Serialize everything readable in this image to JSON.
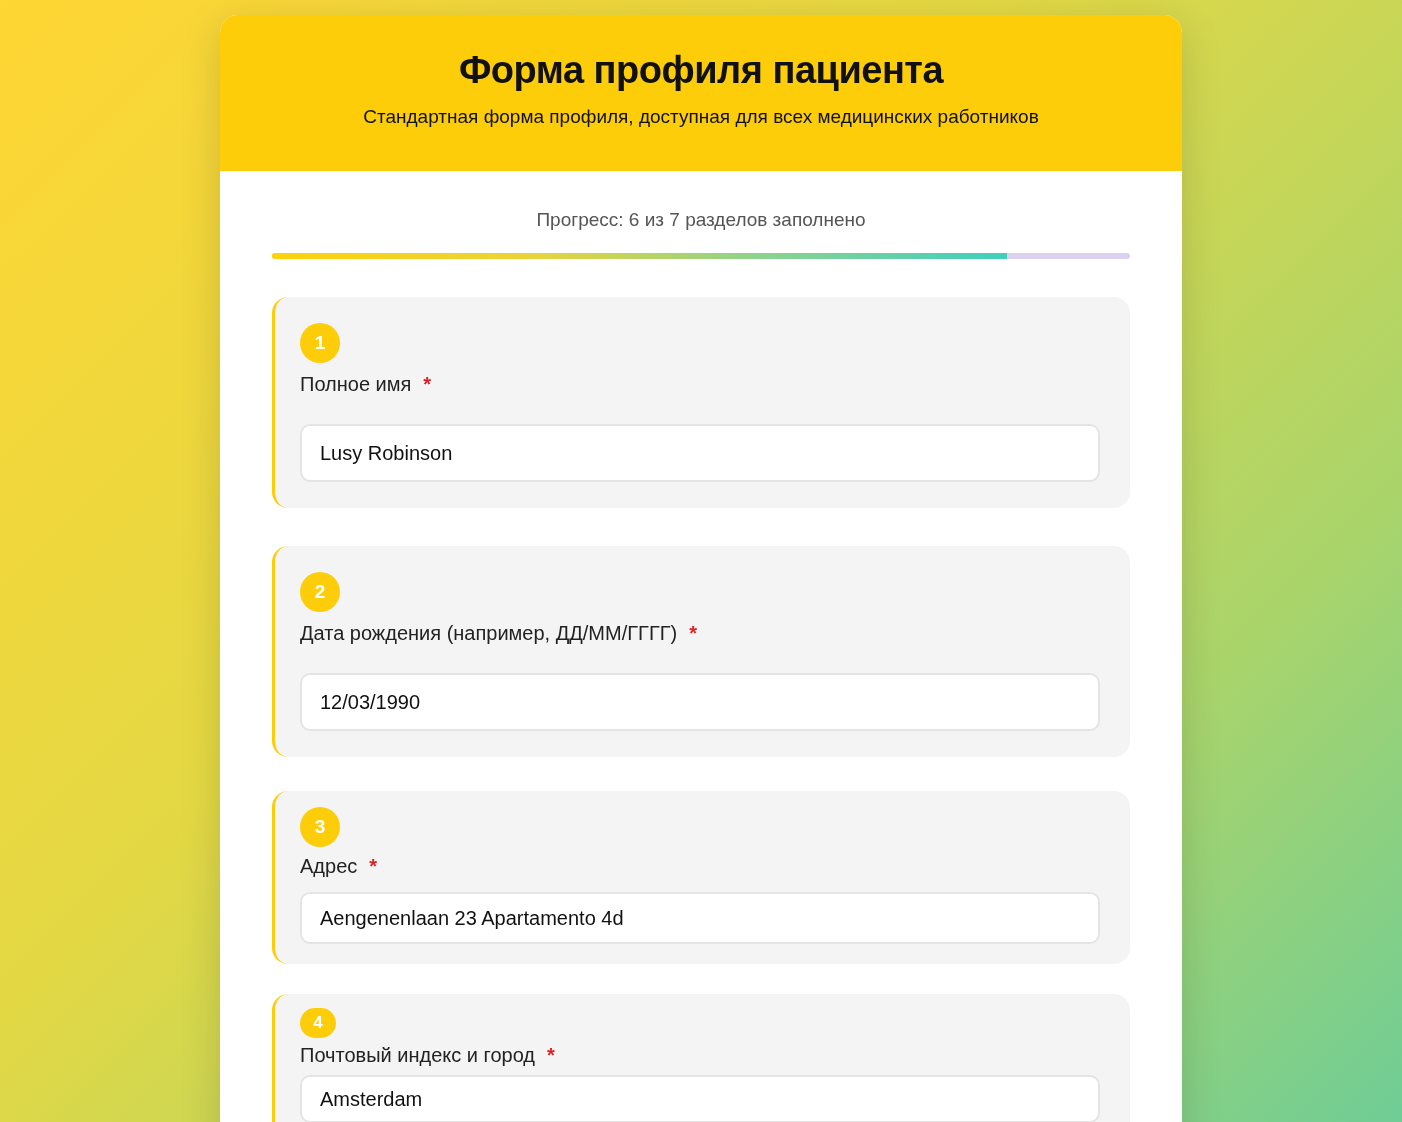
{
  "header": {
    "title": "Форма профиля пациента",
    "subtitle": "Стандартная форма профиля, доступная для всех медицинских работников"
  },
  "progress": {
    "text": "Прогресс: 6 из 7 разделов заполнено",
    "level": 0.857
  },
  "sections": [
    {
      "number": "1",
      "label": "Полное имя",
      "required_mark": "*",
      "value": "Lusy Robinson"
    },
    {
      "number": "2",
      "label": "Дата рождения (например, ДД/ММ/ГГГГ)",
      "required_mark": "*",
      "value": "12/03/1990"
    },
    {
      "number": "3",
      "label": "Адрес",
      "required_mark": "*",
      "value": "Aengenenlaan 23 Apartamento 4d"
    },
    {
      "number": "4",
      "label": "Почтовый индекс и город",
      "required_mark": "*",
      "value": "Amsterdam"
    }
  ]
}
